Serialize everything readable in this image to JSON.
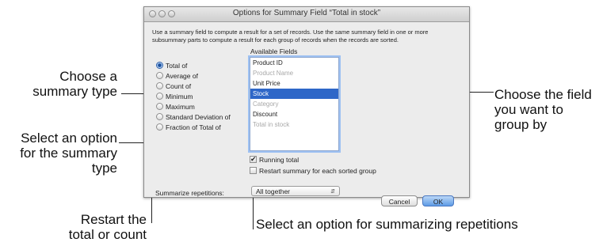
{
  "dialog": {
    "title": "Options for Summary Field “Total in stock”",
    "intro": "Use a summary field to compute a result for a set of records. Use the same summary field in one or more subsummary parts to compute a result for each group of records when the records are sorted.",
    "available_fields_label": "Available Fields",
    "summary_types": [
      {
        "label": "Total of",
        "selected": true
      },
      {
        "label": "Average of",
        "selected": false
      },
      {
        "label": "Count of",
        "selected": false
      },
      {
        "label": "Minimum",
        "selected": false
      },
      {
        "label": "Maximum",
        "selected": false
      },
      {
        "label": "Standard Deviation of",
        "selected": false
      },
      {
        "label": "Fraction of Total of",
        "selected": false
      }
    ],
    "fields": [
      {
        "label": "Product ID",
        "state": "normal"
      },
      {
        "label": "Product Name",
        "state": "disabled"
      },
      {
        "label": "Unit Price",
        "state": "normal"
      },
      {
        "label": "Stock",
        "state": "selected"
      },
      {
        "label": "Category",
        "state": "disabled"
      },
      {
        "label": "Discount",
        "state": "normal"
      },
      {
        "label": "Total in stock",
        "state": "disabled"
      }
    ],
    "running_total_label": "Running total",
    "running_total_checked": true,
    "restart_label": "Restart summary for each sorted group",
    "restart_checked": false,
    "summarize_label": "Summarize repetitions:",
    "summarize_value": "All together",
    "cancel_label": "Cancel",
    "ok_label": "OK"
  },
  "callouts": {
    "summary_type": "Choose a\nsummary type",
    "choose_field": "Choose the field\nyou want to\ngroup by",
    "select_option": "Select an option\nfor the summary\ntype",
    "restart": "Restart the\ntotal or count",
    "repetitions": "Select an option for summarizing repetitions"
  },
  "colors": {
    "selection": "#2e67c8",
    "default_button": "#5d9ce6",
    "focus_ring": "#9ec1f2"
  }
}
